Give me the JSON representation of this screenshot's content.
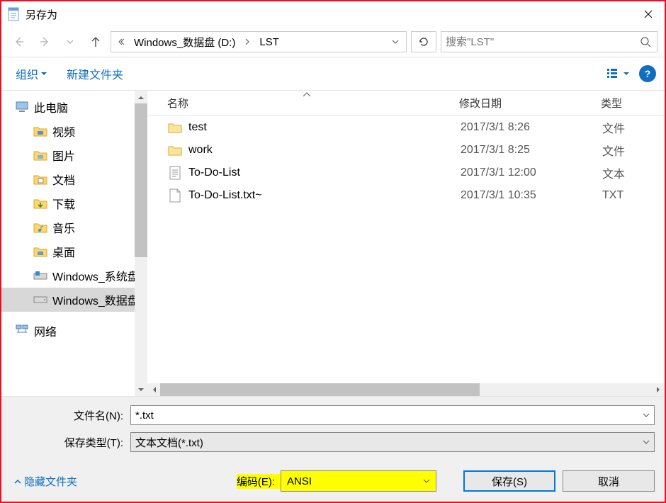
{
  "window": {
    "title": "另存为"
  },
  "breadcrumb": {
    "seg1": "Windows_数据盘 (D:)",
    "seg2": "LST"
  },
  "search": {
    "placeholder": "搜索\"LST\""
  },
  "toolbar": {
    "organize": "组织",
    "newfolder": "新建文件夹"
  },
  "sidebar": {
    "thispc": "此电脑",
    "videos": "视频",
    "pictures": "图片",
    "documents": "文档",
    "downloads": "下载",
    "music": "音乐",
    "desktop": "桌面",
    "sysdrive": "Windows_系统盘",
    "datadrive": "Windows_数据盘",
    "network": "网络"
  },
  "columns": {
    "name": "名称",
    "date": "修改日期",
    "type": "类型"
  },
  "files": [
    {
      "icon": "folder",
      "name": "test",
      "date": "2017/3/1 8:26",
      "type": "文件"
    },
    {
      "icon": "folder",
      "name": "work",
      "date": "2017/3/1 8:25",
      "type": "文件"
    },
    {
      "icon": "text",
      "name": "To-Do-List",
      "date": "2017/3/1 12:00",
      "type": "文本"
    },
    {
      "icon": "file",
      "name": "To-Do-List.txt~",
      "date": "2017/3/1 10:35",
      "type": "TXT"
    }
  ],
  "form": {
    "filename_label": "文件名(N):",
    "filename_value": "*.txt",
    "savetype_label": "保存类型(T):",
    "savetype_value": "文本文档(*.txt)",
    "hide_folders": "隐藏文件夹",
    "encoding_label": "编码(E):",
    "encoding_value": "ANSI",
    "save": "保存(S)",
    "cancel": "取消"
  }
}
